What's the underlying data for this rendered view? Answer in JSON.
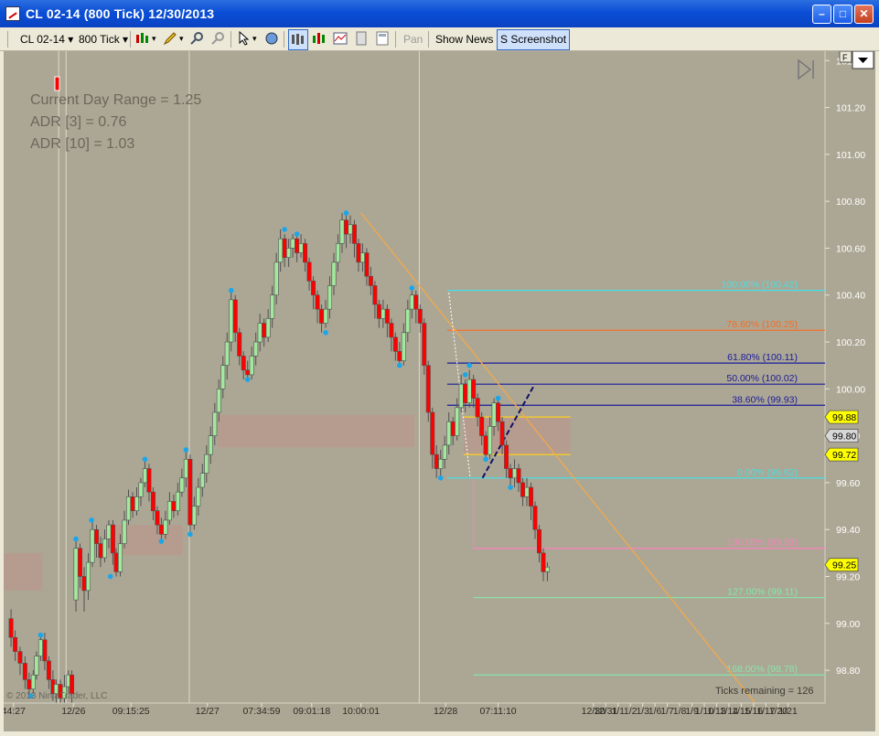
{
  "window": {
    "title": "CL 02-14 (800 Tick)  12/30/2013"
  },
  "toolbar": {
    "instrument": "CL 02-14",
    "interval": "800 Tick",
    "pan_label": "Pan",
    "show_news_label": "Show News",
    "screenshot_label": "S Screenshot"
  },
  "info_panel": {
    "lines": [
      "Current Day Range = 1.25",
      "ADR [3] = 0.76",
      "ADR [10] = 1.03"
    ]
  },
  "copyright": "© 2013 NinjaTrader, LLC",
  "ticks_remaining": "Ticks remaining = 126",
  "f_label": "F",
  "colors": {
    "background": "#aca795",
    "up_bar": "#a2e89e",
    "down_bar": "#ff0000",
    "fib_cyan": "#46e0e6",
    "fib_orange": "#ff6a1a",
    "fib_navy": "#1a1a9a",
    "fib_pink": "#ff7fbf",
    "fib_green": "#86e6a8",
    "trend_line": "#f2a84a"
  },
  "chart_data": {
    "type": "candlestick",
    "instrument": "CL 02-14",
    "interval": "800 Tick",
    "ylim": [
      98.66,
      101.44
    ],
    "y_ticks": [
      "101.40",
      "101.20",
      "101.00",
      "100.80",
      "100.60",
      "100.40",
      "100.20",
      "100.00",
      "99.80",
      "99.60",
      "99.40",
      "99.20",
      "99.00",
      "98.80"
    ],
    "x_tick_labels": [
      "44:27",
      "12/26",
      "09:15:25",
      "12/27",
      "07:34:59",
      "09:01:18",
      "10:00:01",
      "12/28",
      "07:11:10",
      "12/30",
      "12/31",
      "1/1",
      "1/2",
      "1/3",
      "1/6",
      "1/7",
      "1/8",
      "1/9",
      "1/10",
      "1/13",
      "1/14",
      "1/15",
      "1/16",
      "1/17",
      "1/20",
      "1/21"
    ],
    "price_markers": [
      {
        "label": "99.88",
        "value": 99.88,
        "style": "yellow"
      },
      {
        "label": "99.80",
        "value": 99.8,
        "style": "gray"
      },
      {
        "label": "99.72",
        "value": 99.72,
        "style": "yellow"
      },
      {
        "label": "99.25",
        "value": 99.25,
        "style": "yellow"
      }
    ],
    "fib_levels": [
      {
        "label": "100.00% (100.42)",
        "value": 100.42,
        "color": "#46e0e6"
      },
      {
        "label": "78.60% (100.25)",
        "value": 100.25,
        "color": "#ff6a1a"
      },
      {
        "label": "61.80% (100.11)",
        "value": 100.11,
        "color": "#1a1a9a"
      },
      {
        "label": "50.00% (100.02)",
        "value": 100.02,
        "color": "#1a1a9a"
      },
      {
        "label": "38.60% (99.93)",
        "value": 99.93,
        "color": "#1a1a9a"
      },
      {
        "label": "0.00% (99.62)",
        "value": 99.62,
        "color": "#46e0e6"
      },
      {
        "label": "100.00% (99.32)",
        "value": 99.32,
        "color": "#ff7fbf"
      },
      {
        "label": "127.00% (99.11)",
        "value": 99.11,
        "color": "#86e6a8"
      },
      {
        "label": "168.00% (98.78)",
        "value": 98.78,
        "color": "#86e6a8"
      }
    ],
    "range_boxes": [
      {
        "x0": 0.0,
        "x1": 0.047,
        "y0": 99.14,
        "y1": 99.3
      },
      {
        "x0": 0.125,
        "x1": 0.218,
        "y0": 99.29,
        "y1": 99.42
      },
      {
        "x0": 0.26,
        "x1": 0.5,
        "y0": 99.75,
        "y1": 99.89
      },
      {
        "x0": 0.56,
        "x1": 0.69,
        "y0": 99.72,
        "y1": 99.88
      }
    ],
    "sessions_x": [
      0.067,
      0.076,
      0.226,
      0.506
    ],
    "trend_line": {
      "x0": 0.435,
      "y0": 100.75,
      "x1": 0.915,
      "y1": 98.66
    },
    "candles": [
      [
        0.009,
        99.02,
        98.94,
        99.06,
        98.9
      ],
      [
        0.014,
        98.94,
        98.88,
        98.97,
        98.84
      ],
      [
        0.02,
        98.88,
        98.83,
        98.9,
        98.78
      ],
      [
        0.026,
        98.83,
        98.76,
        98.86,
        98.72
      ],
      [
        0.031,
        98.76,
        98.72,
        98.79,
        98.69
      ],
      [
        0.036,
        98.72,
        98.78,
        98.8,
        98.7
      ],
      [
        0.04,
        98.78,
        98.86,
        98.88,
        98.76
      ],
      [
        0.045,
        98.86,
        98.93,
        98.95,
        98.84
      ],
      [
        0.05,
        98.93,
        98.84,
        98.96,
        98.8
      ],
      [
        0.055,
        98.84,
        98.76,
        98.86,
        98.72
      ],
      [
        0.06,
        98.76,
        98.7,
        98.8,
        98.67
      ],
      [
        0.064,
        98.7,
        98.74,
        98.76,
        98.66
      ],
      [
        0.069,
        98.74,
        98.68,
        98.76,
        98.65
      ],
      [
        0.074,
        98.68,
        98.73,
        98.78,
        98.66
      ],
      [
        0.079,
        98.73,
        98.78,
        98.8,
        98.7
      ],
      [
        0.083,
        98.78,
        98.7,
        98.8,
        98.66
      ],
      [
        0.088,
        99.1,
        99.32,
        99.35,
        99.05
      ],
      [
        0.093,
        99.32,
        99.2,
        99.34,
        99.15
      ],
      [
        0.098,
        99.2,
        99.14,
        99.24,
        99.05
      ],
      [
        0.103,
        99.14,
        99.26,
        99.3,
        99.1
      ],
      [
        0.108,
        99.26,
        99.4,
        99.44,
        99.24
      ],
      [
        0.113,
        99.4,
        99.34,
        99.42,
        99.28
      ],
      [
        0.118,
        99.34,
        99.28,
        99.37,
        99.24
      ],
      [
        0.123,
        99.28,
        99.36,
        99.4,
        99.26
      ],
      [
        0.128,
        99.36,
        99.42,
        99.44,
        99.32
      ],
      [
        0.133,
        99.42,
        99.3,
        99.44,
        99.25
      ],
      [
        0.137,
        99.3,
        99.22,
        99.32,
        99.2
      ],
      [
        0.142,
        99.22,
        99.34,
        99.38,
        99.2
      ],
      [
        0.147,
        99.34,
        99.44,
        99.48,
        99.32
      ],
      [
        0.152,
        99.44,
        99.54,
        99.57,
        99.42
      ],
      [
        0.157,
        99.54,
        99.48,
        99.56,
        99.45
      ],
      [
        0.162,
        99.48,
        99.54,
        99.58,
        99.46
      ],
      [
        0.167,
        99.54,
        99.6,
        99.62,
        99.5
      ],
      [
        0.172,
        99.6,
        99.66,
        99.7,
        99.58
      ],
      [
        0.177,
        99.66,
        99.56,
        99.68,
        99.52
      ],
      [
        0.182,
        99.56,
        99.48,
        99.58,
        99.44
      ],
      [
        0.187,
        99.48,
        99.42,
        99.5,
        99.38
      ],
      [
        0.192,
        99.42,
        99.38,
        99.45,
        99.35
      ],
      [
        0.197,
        99.38,
        99.44,
        99.48,
        99.36
      ],
      [
        0.202,
        99.44,
        99.52,
        99.56,
        99.42
      ],
      [
        0.207,
        99.52,
        99.48,
        99.55,
        99.45
      ],
      [
        0.212,
        99.48,
        99.56,
        99.6,
        99.46
      ],
      [
        0.217,
        99.56,
        99.62,
        99.66,
        99.54
      ],
      [
        0.222,
        99.62,
        99.7,
        99.74,
        99.58
      ],
      [
        0.227,
        99.7,
        99.42,
        99.72,
        99.38
      ],
      [
        0.232,
        99.42,
        99.5,
        99.54,
        99.4
      ],
      [
        0.237,
        99.5,
        99.58,
        99.62,
        99.46
      ],
      [
        0.242,
        99.58,
        99.64,
        99.68,
        99.54
      ],
      [
        0.247,
        99.64,
        99.72,
        99.76,
        99.6
      ],
      [
        0.252,
        99.72,
        99.8,
        99.84,
        99.68
      ],
      [
        0.257,
        99.8,
        99.9,
        99.94,
        99.76
      ],
      [
        0.262,
        99.9,
        100.0,
        100.04,
        99.86
      ],
      [
        0.267,
        100.0,
        100.1,
        100.14,
        99.96
      ],
      [
        0.272,
        100.1,
        100.2,
        100.24,
        100.04
      ],
      [
        0.277,
        100.2,
        100.38,
        100.42,
        100.16
      ],
      [
        0.282,
        100.38,
        100.24,
        100.4,
        100.2
      ],
      [
        0.287,
        100.24,
        100.14,
        100.26,
        100.1
      ],
      [
        0.292,
        100.14,
        100.08,
        100.16,
        100.04
      ],
      [
        0.297,
        100.08,
        100.06,
        100.12,
        100.04
      ],
      [
        0.302,
        100.06,
        100.14,
        100.18,
        100.04
      ],
      [
        0.307,
        100.14,
        100.2,
        100.24,
        100.1
      ],
      [
        0.312,
        100.2,
        100.28,
        100.32,
        100.16
      ],
      [
        0.317,
        100.28,
        100.22,
        100.3,
        100.18
      ],
      [
        0.322,
        100.22,
        100.3,
        100.34,
        100.2
      ],
      [
        0.327,
        100.3,
        100.4,
        100.44,
        100.26
      ],
      [
        0.332,
        100.4,
        100.54,
        100.58,
        100.36
      ],
      [
        0.337,
        100.54,
        100.64,
        100.68,
        100.5
      ],
      [
        0.342,
        100.64,
        100.56,
        100.66,
        100.52
      ],
      [
        0.347,
        100.56,
        100.6,
        100.64,
        100.52
      ],
      [
        0.352,
        100.6,
        100.64,
        100.66,
        100.56
      ],
      [
        0.357,
        100.64,
        100.58,
        100.66,
        100.54
      ],
      [
        0.362,
        100.58,
        100.62,
        100.66,
        100.56
      ],
      [
        0.367,
        100.62,
        100.54,
        100.64,
        100.5
      ],
      [
        0.372,
        100.54,
        100.46,
        100.56,
        100.42
      ],
      [
        0.377,
        100.46,
        100.4,
        100.48,
        100.34
      ],
      [
        0.382,
        100.4,
        100.34,
        100.42,
        100.28
      ],
      [
        0.387,
        100.34,
        100.28,
        100.36,
        100.24
      ],
      [
        0.392,
        100.28,
        100.34,
        100.38,
        100.26
      ],
      [
        0.397,
        100.34,
        100.44,
        100.48,
        100.3
      ],
      [
        0.402,
        100.44,
        100.54,
        100.58,
        100.4
      ],
      [
        0.407,
        100.54,
        100.62,
        100.66,
        100.5
      ],
      [
        0.412,
        100.62,
        100.72,
        100.75,
        100.58
      ],
      [
        0.417,
        100.72,
        100.66,
        100.74,
        100.6
      ],
      [
        0.422,
        100.66,
        100.7,
        100.74,
        100.62
      ],
      [
        0.427,
        100.7,
        100.62,
        100.72,
        100.56
      ],
      [
        0.432,
        100.62,
        100.54,
        100.64,
        100.5
      ],
      [
        0.437,
        100.54,
        100.58,
        100.62,
        100.5
      ],
      [
        0.442,
        100.58,
        100.48,
        100.6,
        100.44
      ],
      [
        0.447,
        100.48,
        100.44,
        100.52,
        100.4
      ],
      [
        0.452,
        100.44,
        100.36,
        100.46,
        100.3
      ],
      [
        0.457,
        100.36,
        100.3,
        100.38,
        100.26
      ],
      [
        0.462,
        100.3,
        100.34,
        100.38,
        100.26
      ],
      [
        0.467,
        100.34,
        100.28,
        100.36,
        100.22
      ],
      [
        0.472,
        100.28,
        100.22,
        100.3,
        100.16
      ],
      [
        0.477,
        100.22,
        100.16,
        100.24,
        100.12
      ],
      [
        0.482,
        100.16,
        100.12,
        100.2,
        100.1
      ],
      [
        0.487,
        100.12,
        100.24,
        100.28,
        100.1
      ],
      [
        0.492,
        100.24,
        100.34,
        100.38,
        100.2
      ],
      [
        0.497,
        100.34,
        100.4,
        100.43,
        100.3
      ],
      [
        0.502,
        100.4,
        100.34,
        100.42,
        100.28
      ],
      [
        0.507,
        100.34,
        100.28,
        100.36,
        100.24
      ],
      [
        0.512,
        100.28,
        100.1,
        100.3,
        100.06
      ],
      [
        0.517,
        100.1,
        99.9,
        100.12,
        99.86
      ],
      [
        0.522,
        99.9,
        99.72,
        99.92,
        99.66
      ],
      [
        0.527,
        99.72,
        99.66,
        99.76,
        99.62
      ],
      [
        0.532,
        99.66,
        99.7,
        99.74,
        99.62
      ],
      [
        0.537,
        99.7,
        99.76,
        99.8,
        99.66
      ],
      [
        0.542,
        99.76,
        99.86,
        99.9,
        99.72
      ],
      [
        0.547,
        99.86,
        99.8,
        99.88,
        99.76
      ],
      [
        0.552,
        99.8,
        99.92,
        99.96,
        99.78
      ],
      [
        0.557,
        99.92,
        100.02,
        100.06,
        99.9
      ],
      [
        0.562,
        100.02,
        99.94,
        100.04,
        99.9
      ],
      [
        0.567,
        99.94,
        100.04,
        100.08,
        99.92
      ],
      [
        0.572,
        100.04,
        99.96,
        100.06,
        99.92
      ],
      [
        0.577,
        99.96,
        99.88,
        99.98,
        99.84
      ],
      [
        0.582,
        99.88,
        99.8,
        99.9,
        99.76
      ],
      [
        0.587,
        99.8,
        99.72,
        99.82,
        99.7
      ],
      [
        0.592,
        99.72,
        99.84,
        99.88,
        99.7
      ],
      [
        0.597,
        99.84,
        99.94,
        99.96,
        99.8
      ],
      [
        0.602,
        99.94,
        99.86,
        99.96,
        99.82
      ],
      [
        0.607,
        99.86,
        99.76,
        99.88,
        99.72
      ],
      [
        0.612,
        99.76,
        99.66,
        99.78,
        99.62
      ],
      [
        0.617,
        99.66,
        99.62,
        99.68,
        99.58
      ],
      [
        0.622,
        99.62,
        99.66,
        99.7,
        99.58
      ],
      [
        0.627,
        99.66,
        99.6,
        99.68,
        99.56
      ],
      [
        0.632,
        99.6,
        99.54,
        99.62,
        99.5
      ],
      [
        0.637,
        99.54,
        99.58,
        99.62,
        99.5
      ],
      [
        0.642,
        99.58,
        99.5,
        99.6,
        99.44
      ],
      [
        0.647,
        99.5,
        99.4,
        99.52,
        99.36
      ],
      [
        0.652,
        99.4,
        99.3,
        99.42,
        99.26
      ],
      [
        0.657,
        99.3,
        99.22,
        99.32,
        99.18
      ],
      [
        0.662,
        99.22,
        99.24,
        99.26,
        99.18
      ]
    ],
    "swing_points": [
      [
        0.033,
        98.69
      ],
      [
        0.045,
        98.95
      ],
      [
        0.088,
        99.36
      ],
      [
        0.107,
        99.44
      ],
      [
        0.13,
        99.2
      ],
      [
        0.172,
        99.7
      ],
      [
        0.192,
        99.35
      ],
      [
        0.222,
        99.74
      ],
      [
        0.227,
        99.38
      ],
      [
        0.277,
        100.42
      ],
      [
        0.297,
        100.04
      ],
      [
        0.342,
        100.68
      ],
      [
        0.357,
        100.66
      ],
      [
        0.392,
        100.24
      ],
      [
        0.417,
        100.75
      ],
      [
        0.482,
        100.1
      ],
      [
        0.497,
        100.43
      ],
      [
        0.532,
        99.62
      ],
      [
        0.562,
        100.06
      ],
      [
        0.567,
        100.1
      ],
      [
        0.587,
        99.7
      ],
      [
        0.602,
        99.96
      ],
      [
        0.617,
        99.58
      ]
    ]
  }
}
